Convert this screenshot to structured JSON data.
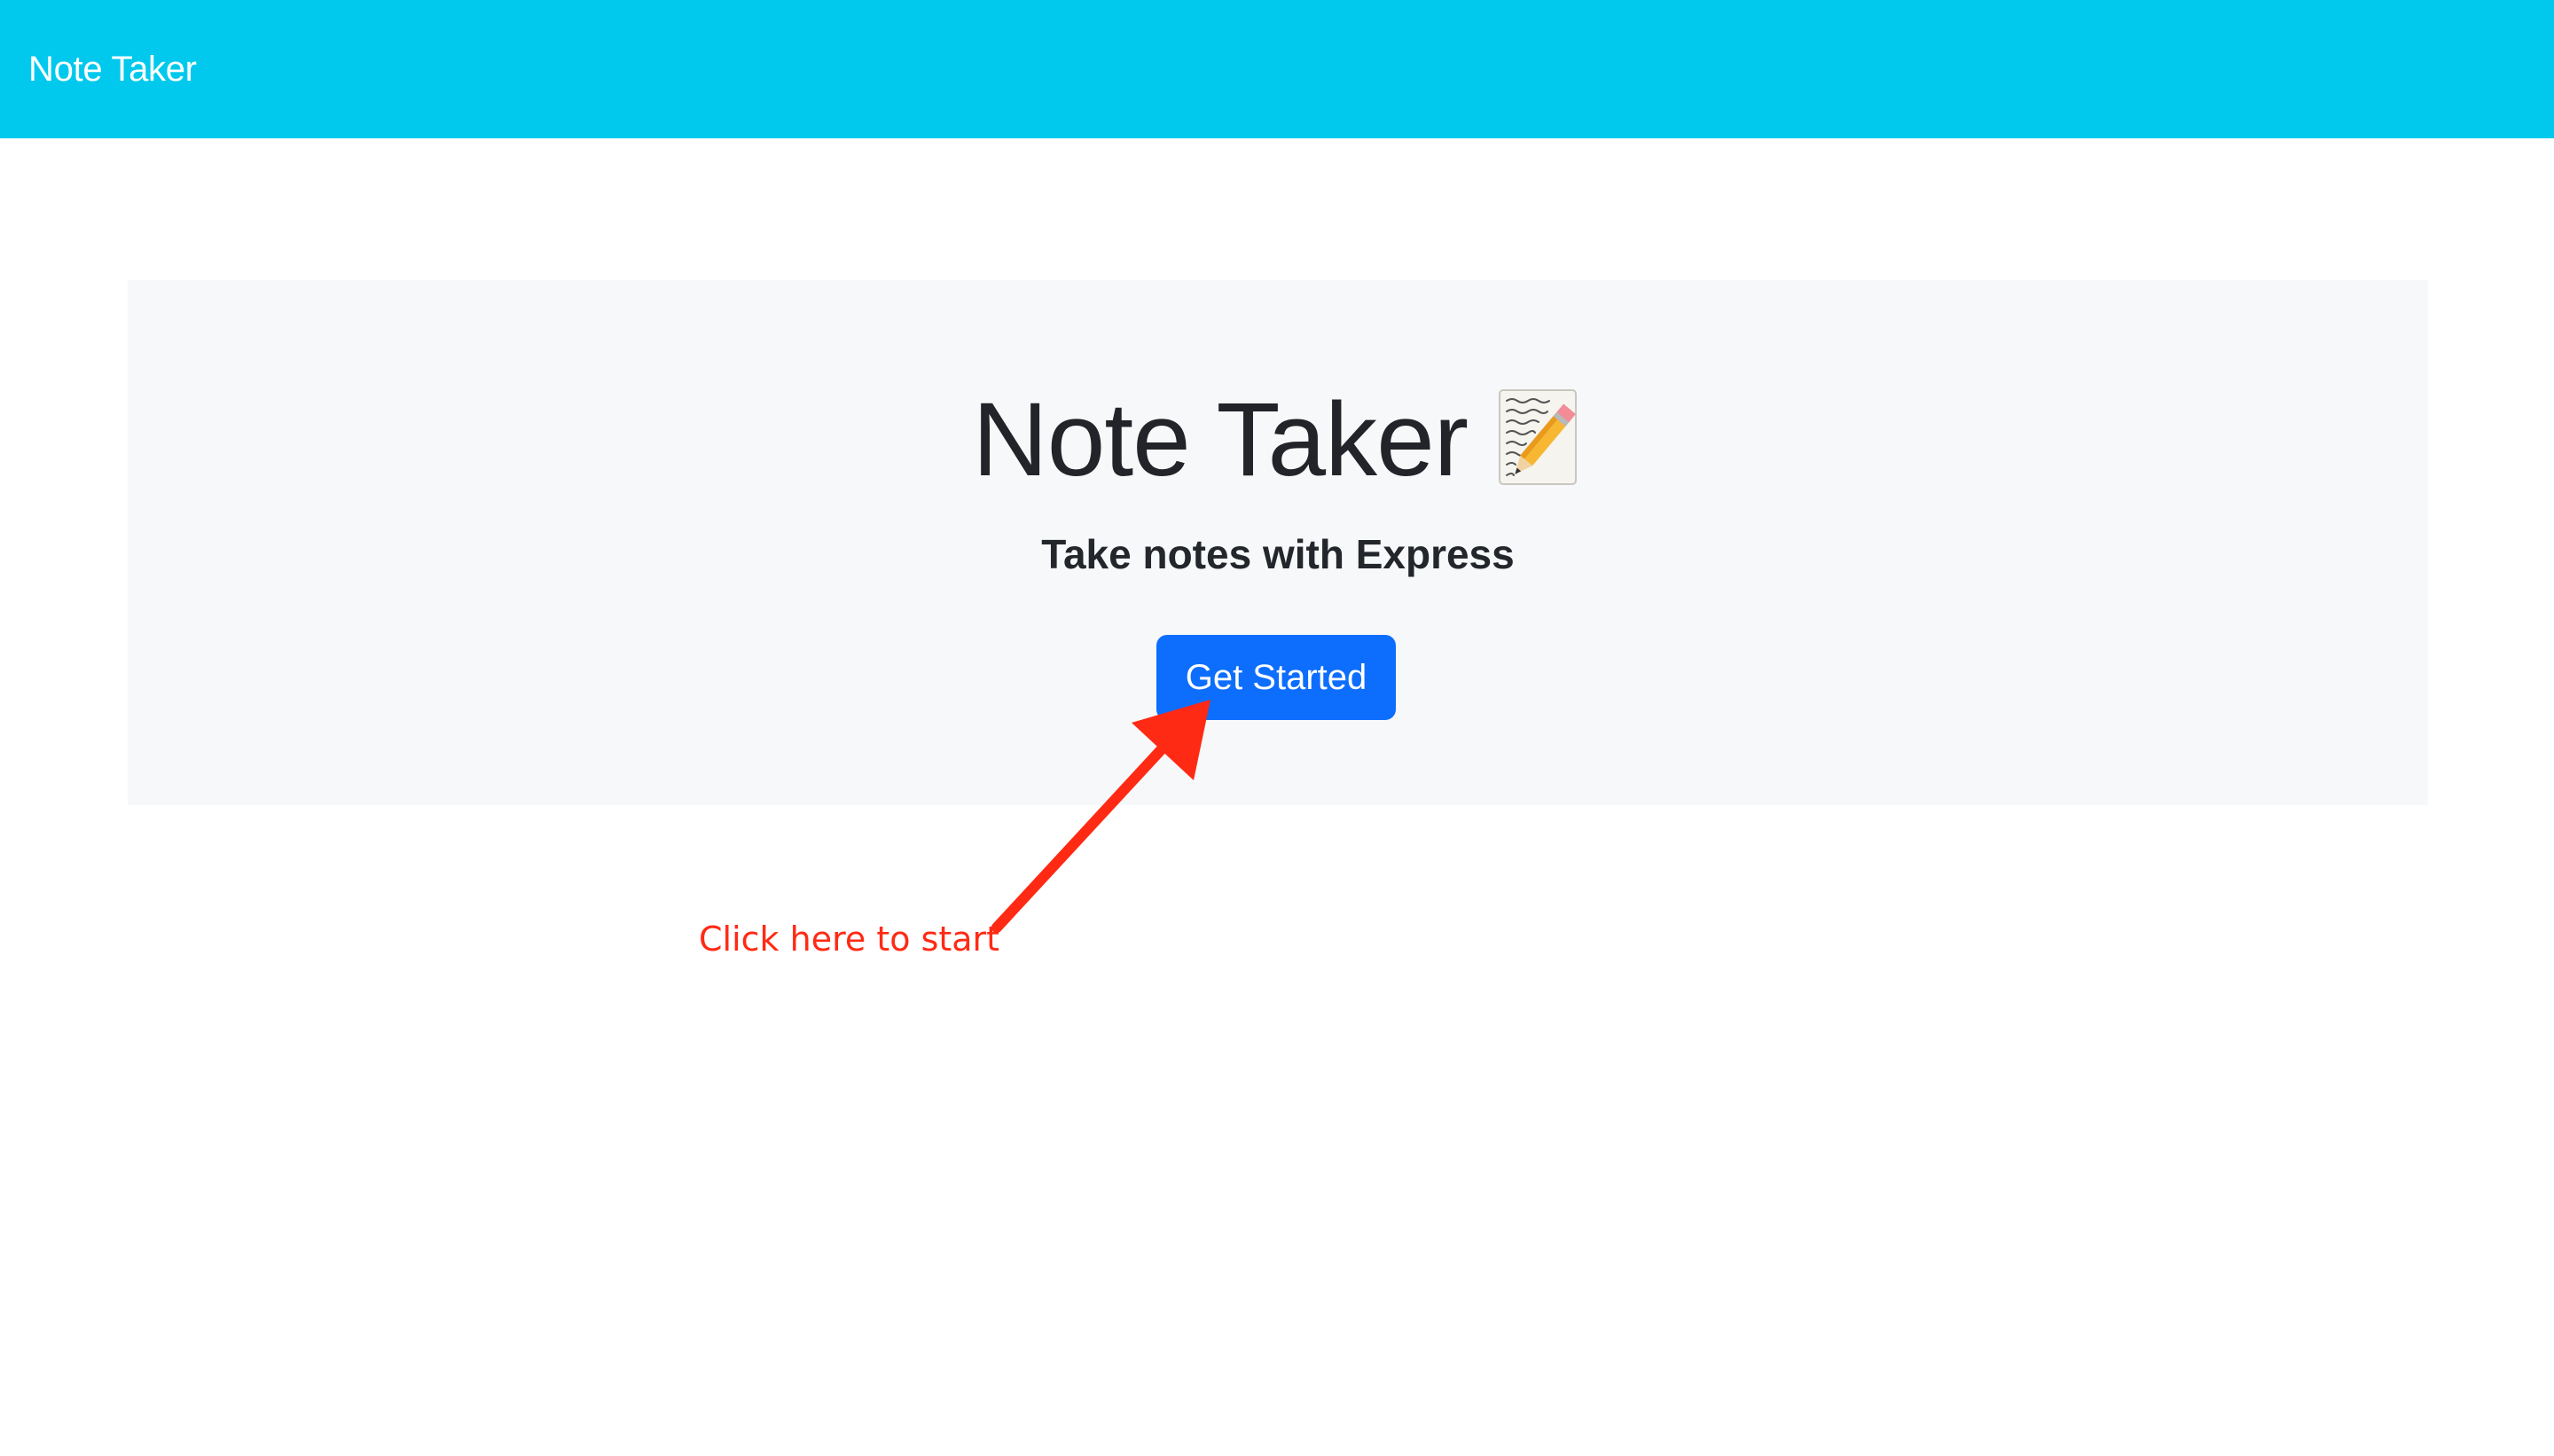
{
  "navbar": {
    "brand": "Note Taker"
  },
  "hero": {
    "title": "Note Taker",
    "title_icon": "memo-icon",
    "subtitle": "Take notes with Express",
    "button_label": "Get Started"
  },
  "annotation": {
    "text": "Click here to start",
    "color": "#ff2a14",
    "icon": "arrow-icon"
  },
  "colors": {
    "navbar": "#00c9ed",
    "jumbotron": "#f7f8f9",
    "button": "#0d6efd"
  }
}
